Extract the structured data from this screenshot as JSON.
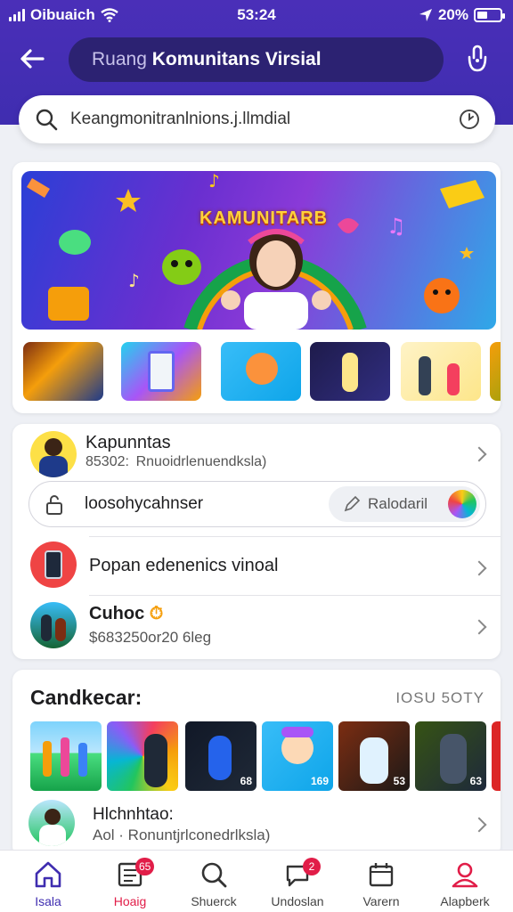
{
  "status_bar": {
    "carrier": "Oibuaich",
    "time": "53:24",
    "battery": "20%"
  },
  "header": {
    "title_prefix": "Ruang",
    "title_main": "Komunitans Virsial"
  },
  "search": {
    "value": "Keangmonitranlnions.j.llmdial"
  },
  "banner": {
    "title": "KAMUNITARB"
  },
  "community": {
    "row1": {
      "title": "Kapunntas",
      "subtitle": "85302:  Rnuoidrlenuendksla)"
    },
    "input": {
      "value": "loosohycahnser",
      "button": "Ralodaril"
    },
    "row2": {
      "title": "Popan edenenics vinoal"
    },
    "row3": {
      "title": "Cuhoc",
      "subtitle": "$683250or20 6leg"
    }
  },
  "recommendations": {
    "title": "Candkecar:",
    "more": "IOSU 5OTY",
    "thumb_counts": [
      "",
      "",
      "68",
      "169",
      "53",
      "63"
    ],
    "row": {
      "title": "Hlchnhtao:",
      "subtitle": "Aol · Ronuntjrlconedrlksla)"
    }
  },
  "nav": [
    {
      "label": "Isala"
    },
    {
      "label": "Hoaig",
      "badge": "65"
    },
    {
      "label": "Shuerck"
    },
    {
      "label": "Undoslan",
      "badge": "2"
    },
    {
      "label": "Varern"
    },
    {
      "label": "Alapberk"
    }
  ],
  "colors": {
    "header": "#4a2fb8",
    "accent": "#3f2db0",
    "badge": "#e11d48",
    "active_nav_icon": "#e11d48"
  }
}
